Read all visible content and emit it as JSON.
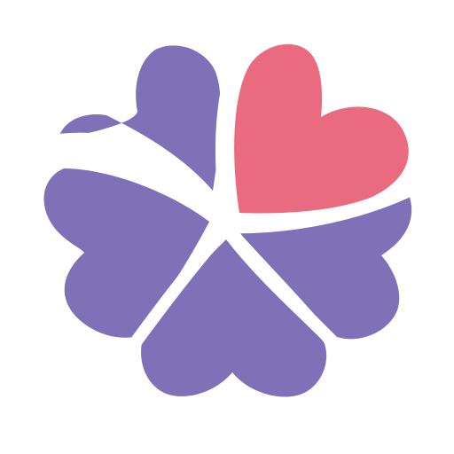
{
  "logo": {
    "name": "heart-clover-logo",
    "colors": {
      "background": "#ffffff",
      "petal_primary": "#7f71b8",
      "petal_accent": "#ea6b80",
      "separator": "#ffffff"
    },
    "petals": [
      {
        "name": "top-heart",
        "color_key": "petal_accent"
      },
      {
        "name": "upper-left-heart",
        "color_key": "petal_primary"
      },
      {
        "name": "left-heart",
        "color_key": "petal_primary"
      },
      {
        "name": "bottom-heart",
        "color_key": "petal_primary"
      },
      {
        "name": "right-heart",
        "color_key": "petal_primary"
      }
    ]
  }
}
